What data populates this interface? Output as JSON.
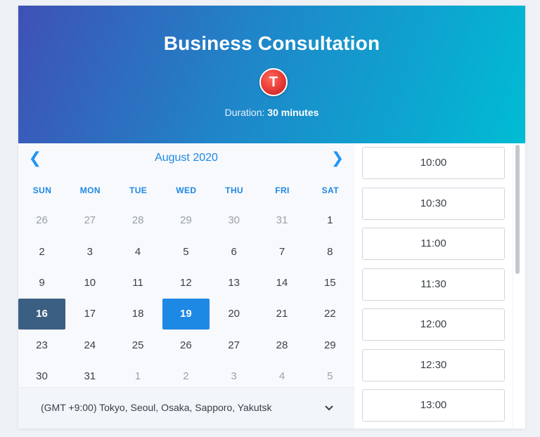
{
  "header": {
    "title": "Business Consultation",
    "avatar_letter": "T",
    "duration_label": "Duration:",
    "duration_value": "30 minutes"
  },
  "calendar": {
    "month": "August 2020",
    "prev_icon": "chevron-left-icon",
    "next_icon": "chevron-right-icon",
    "weekdays": [
      "SUN",
      "MON",
      "TUE",
      "WED",
      "THU",
      "FRI",
      "SAT"
    ],
    "weeks": [
      [
        {
          "d": "26",
          "muted": true
        },
        {
          "d": "27",
          "muted": true
        },
        {
          "d": "28",
          "muted": true
        },
        {
          "d": "29",
          "muted": true
        },
        {
          "d": "30",
          "muted": true
        },
        {
          "d": "31",
          "muted": true
        },
        {
          "d": "1"
        }
      ],
      [
        {
          "d": "2"
        },
        {
          "d": "3"
        },
        {
          "d": "4"
        },
        {
          "d": "5"
        },
        {
          "d": "6"
        },
        {
          "d": "7"
        },
        {
          "d": "8"
        }
      ],
      [
        {
          "d": "9"
        },
        {
          "d": "10"
        },
        {
          "d": "11"
        },
        {
          "d": "12"
        },
        {
          "d": "13"
        },
        {
          "d": "14"
        },
        {
          "d": "15"
        }
      ],
      [
        {
          "d": "16",
          "state": "today"
        },
        {
          "d": "17"
        },
        {
          "d": "18"
        },
        {
          "d": "19",
          "state": "selected"
        },
        {
          "d": "20"
        },
        {
          "d": "21"
        },
        {
          "d": "22"
        }
      ],
      [
        {
          "d": "23"
        },
        {
          "d": "24"
        },
        {
          "d": "25"
        },
        {
          "d": "26"
        },
        {
          "d": "27"
        },
        {
          "d": "28"
        },
        {
          "d": "29"
        }
      ],
      [
        {
          "d": "30"
        },
        {
          "d": "31"
        },
        {
          "d": "1",
          "muted": true
        },
        {
          "d": "2",
          "muted": true
        },
        {
          "d": "3",
          "muted": true
        },
        {
          "d": "4",
          "muted": true
        },
        {
          "d": "5",
          "muted": true
        }
      ]
    ],
    "timezone": "(GMT +9:00) Tokyo, Seoul, Osaka, Sapporo, Yakutsk",
    "timezone_icon": "chevron-down-icon"
  },
  "slots": {
    "times": [
      "10:00",
      "10:30",
      "11:00",
      "11:30",
      "12:00",
      "12:30",
      "13:00"
    ]
  },
  "colors": {
    "accent": "#1e88e5",
    "today": "#3b5f82",
    "header_start": "#3f51b5",
    "header_end": "#00bcd4",
    "avatar": "#e53935"
  }
}
